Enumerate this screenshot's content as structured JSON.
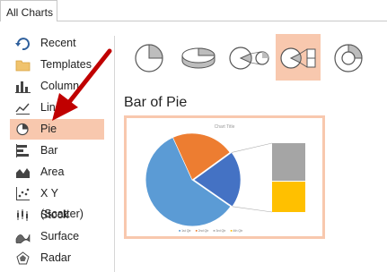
{
  "tab": {
    "label": "All Charts"
  },
  "sidebar": {
    "items": [
      {
        "label": "Recent",
        "icon": "recent-icon"
      },
      {
        "label": "Templates",
        "icon": "templates-folder-icon"
      },
      {
        "label": "Column",
        "icon": "column-chart-icon"
      },
      {
        "label": "Line",
        "icon": "line-chart-icon"
      },
      {
        "label": "Pie",
        "icon": "pie-chart-icon",
        "selected": true
      },
      {
        "label": "Bar",
        "icon": "bar-chart-icon"
      },
      {
        "label": "Area",
        "icon": "area-chart-icon"
      },
      {
        "label": "X Y (Scatter)",
        "icon": "scatter-chart-icon"
      },
      {
        "label": "Stock",
        "icon": "stock-chart-icon"
      },
      {
        "label": "Surface",
        "icon": "surface-chart-icon"
      },
      {
        "label": "Radar",
        "icon": "radar-chart-icon"
      }
    ]
  },
  "subtypes": [
    {
      "icon": "pie-subtype-icon"
    },
    {
      "icon": "3d-pie-subtype-icon"
    },
    {
      "icon": "pie-of-pie-subtype-icon"
    },
    {
      "icon": "bar-of-pie-subtype-icon",
      "selected": true
    },
    {
      "icon": "doughnut-subtype-icon"
    }
  ],
  "main": {
    "subtype_title": "Bar of Pie"
  },
  "preview": {
    "chart_title": "Chart Title",
    "legend": [
      "1st Qtr",
      "2nd Qtr",
      "3rd Qtr",
      "4th Qtr"
    ]
  },
  "colors": {
    "selection": "#f8c8ae",
    "pie_blue": "#5b9bd5",
    "pie_orange": "#ed7d31",
    "pie_darkblue": "#4472c4",
    "bar_gray": "#a5a5a5",
    "bar_yellow": "#ffc000",
    "arrow_red": "#c00000"
  }
}
